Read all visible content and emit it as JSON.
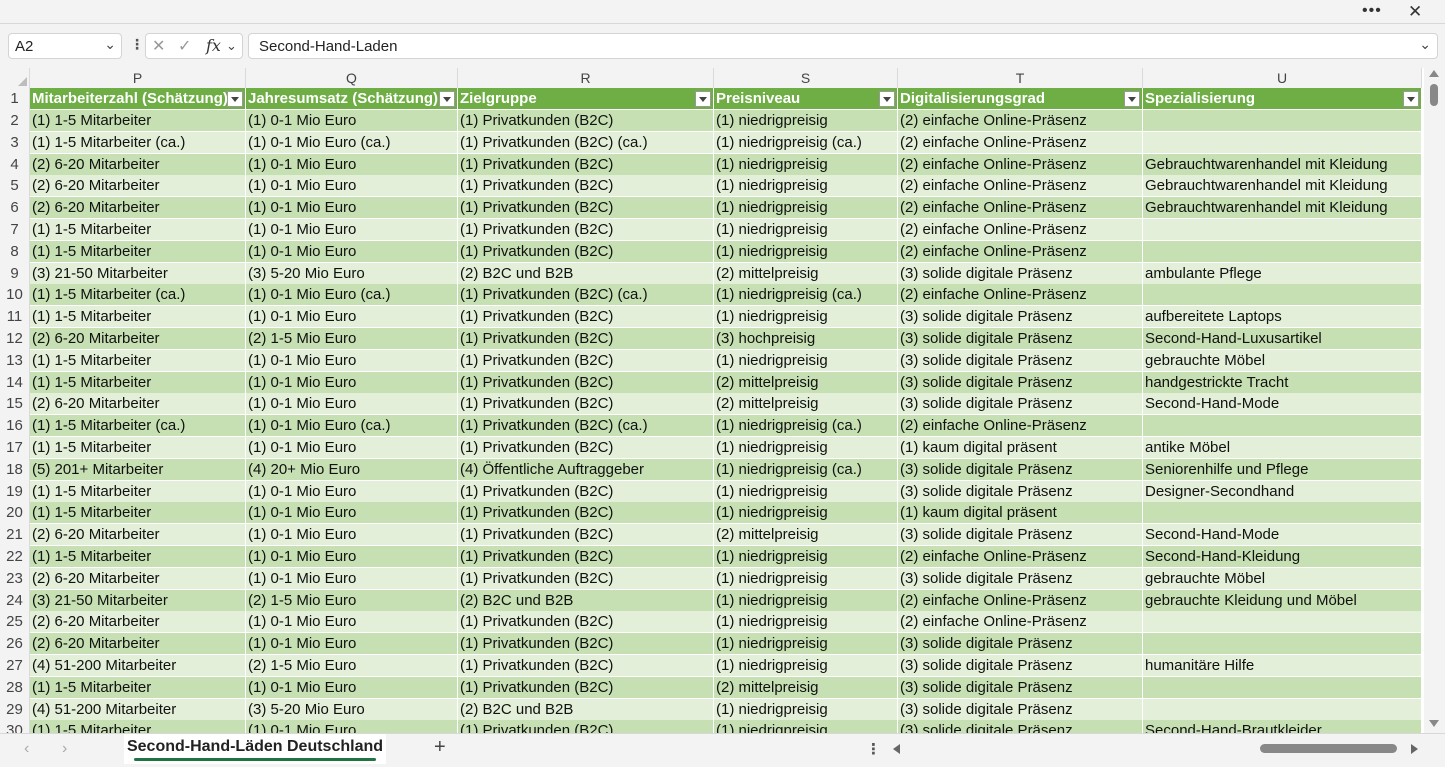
{
  "window": {
    "more_label": "•••",
    "close_label": "✕"
  },
  "formula_bar": {
    "name_box": "A2",
    "value": "Second-Hand-Laden",
    "cancel_icon": "✕",
    "enter_icon": "✓",
    "fx_label": "fx"
  },
  "columns": [
    "P",
    "Q",
    "R",
    "S",
    "T",
    "U"
  ],
  "header_row": {
    "number": "1",
    "cells": [
      "Mitarbeiterzahl (Schätzung)",
      "Jahresumsatz (Schätzung)",
      "Zielgruppe",
      "Preisniveau",
      "Digitalisierungsgrad",
      "Spezialisierung"
    ]
  },
  "rows": [
    {
      "number": "2",
      "cells": [
        "(1) 1-5 Mitarbeiter",
        "(1) 0-1 Mio Euro",
        "(1) Privatkunden (B2C)",
        "(1) niedrigpreisig",
        "(2) einfache Online-Präsenz",
        ""
      ]
    },
    {
      "number": "3",
      "cells": [
        "(1) 1-5 Mitarbeiter (ca.)",
        "(1) 0-1 Mio Euro (ca.)",
        "(1) Privatkunden (B2C) (ca.)",
        "(1) niedrigpreisig (ca.)",
        "(2) einfache Online-Präsenz",
        ""
      ]
    },
    {
      "number": "4",
      "cells": [
        "(2) 6-20 Mitarbeiter",
        "(1) 0-1 Mio Euro",
        "(1) Privatkunden (B2C)",
        "(1) niedrigpreisig",
        "(2) einfache Online-Präsenz",
        "Gebrauchtwarenhandel mit Kleidung"
      ]
    },
    {
      "number": "5",
      "cells": [
        "(2) 6-20 Mitarbeiter",
        "(1) 0-1 Mio Euro",
        "(1) Privatkunden (B2C)",
        "(1) niedrigpreisig",
        "(2) einfache Online-Präsenz",
        "Gebrauchtwarenhandel mit Kleidung"
      ]
    },
    {
      "number": "6",
      "cells": [
        "(2) 6-20 Mitarbeiter",
        "(1) 0-1 Mio Euro",
        "(1) Privatkunden (B2C)",
        "(1) niedrigpreisig",
        "(2) einfache Online-Präsenz",
        "Gebrauchtwarenhandel mit Kleidung"
      ]
    },
    {
      "number": "7",
      "cells": [
        "(1) 1-5 Mitarbeiter",
        "(1) 0-1 Mio Euro",
        "(1) Privatkunden (B2C)",
        "(1) niedrigpreisig",
        "(2) einfache Online-Präsenz",
        ""
      ]
    },
    {
      "number": "8",
      "cells": [
        "(1) 1-5 Mitarbeiter",
        "(1) 0-1 Mio Euro",
        "(1) Privatkunden (B2C)",
        "(1) niedrigpreisig",
        "(2) einfache Online-Präsenz",
        ""
      ]
    },
    {
      "number": "9",
      "cells": [
        "(3) 21-50 Mitarbeiter",
        "(3) 5-20 Mio Euro",
        "(2) B2C und B2B",
        "(2) mittelpreisig",
        "(3) solide digitale Präsenz",
        "ambulante Pflege"
      ]
    },
    {
      "number": "10",
      "cells": [
        "(1) 1-5 Mitarbeiter (ca.)",
        "(1) 0-1 Mio Euro (ca.)",
        "(1) Privatkunden (B2C) (ca.)",
        "(1) niedrigpreisig (ca.)",
        "(2) einfache Online-Präsenz",
        ""
      ]
    },
    {
      "number": "11",
      "cells": [
        "(1) 1-5 Mitarbeiter",
        "(1) 0-1 Mio Euro",
        "(1) Privatkunden (B2C)",
        "(1) niedrigpreisig",
        "(3) solide digitale Präsenz",
        "aufbereitete Laptops"
      ]
    },
    {
      "number": "12",
      "cells": [
        "(2) 6-20 Mitarbeiter",
        "(2) 1-5 Mio Euro",
        "(1) Privatkunden (B2C)",
        "(3) hochpreisig",
        "(3) solide digitale Präsenz",
        "Second-Hand-Luxusartikel"
      ]
    },
    {
      "number": "13",
      "cells": [
        "(1) 1-5 Mitarbeiter",
        "(1) 0-1 Mio Euro",
        "(1) Privatkunden (B2C)",
        "(1) niedrigpreisig",
        "(3) solide digitale Präsenz",
        "gebrauchte Möbel"
      ]
    },
    {
      "number": "14",
      "cells": [
        "(1) 1-5 Mitarbeiter",
        "(1) 0-1 Mio Euro",
        "(1) Privatkunden (B2C)",
        "(2) mittelpreisig",
        "(3) solide digitale Präsenz",
        "handgestrickte Tracht"
      ]
    },
    {
      "number": "15",
      "cells": [
        "(2) 6-20 Mitarbeiter",
        "(1) 0-1 Mio Euro",
        "(1) Privatkunden (B2C)",
        "(2) mittelpreisig",
        "(3) solide digitale Präsenz",
        "Second-Hand-Mode"
      ]
    },
    {
      "number": "16",
      "cells": [
        "(1) 1-5 Mitarbeiter (ca.)",
        "(1) 0-1 Mio Euro (ca.)",
        "(1) Privatkunden (B2C) (ca.)",
        "(1) niedrigpreisig (ca.)",
        "(2) einfache Online-Präsenz",
        ""
      ]
    },
    {
      "number": "17",
      "cells": [
        "(1) 1-5 Mitarbeiter",
        "(1) 0-1 Mio Euro",
        "(1) Privatkunden (B2C)",
        "(1) niedrigpreisig",
        "(1) kaum digital präsent",
        "antike Möbel"
      ]
    },
    {
      "number": "18",
      "cells": [
        "(5) 201+ Mitarbeiter",
        "(4) 20+ Mio Euro",
        "(4) Öffentliche Auftraggeber",
        "(1) niedrigpreisig (ca.)",
        "(3) solide digitale Präsenz",
        "Seniorenhilfe und Pflege"
      ]
    },
    {
      "number": "19",
      "cells": [
        "(1) 1-5 Mitarbeiter",
        "(1) 0-1 Mio Euro",
        "(1) Privatkunden (B2C)",
        "(1) niedrigpreisig",
        "(3) solide digitale Präsenz",
        "Designer-Secondhand"
      ]
    },
    {
      "number": "20",
      "cells": [
        "(1) 1-5 Mitarbeiter",
        "(1) 0-1 Mio Euro",
        "(1) Privatkunden (B2C)",
        "(1) niedrigpreisig",
        "(1) kaum digital präsent",
        ""
      ]
    },
    {
      "number": "21",
      "cells": [
        "(2) 6-20 Mitarbeiter",
        "(1) 0-1 Mio Euro",
        "(1) Privatkunden (B2C)",
        "(2) mittelpreisig",
        "(3) solide digitale Präsenz",
        "Second-Hand-Mode"
      ]
    },
    {
      "number": "22",
      "cells": [
        "(1) 1-5 Mitarbeiter",
        "(1) 0-1 Mio Euro",
        "(1) Privatkunden (B2C)",
        "(1) niedrigpreisig",
        "(2) einfache Online-Präsenz",
        "Second-Hand-Kleidung"
      ]
    },
    {
      "number": "23",
      "cells": [
        "(2) 6-20 Mitarbeiter",
        "(1) 0-1 Mio Euro",
        "(1) Privatkunden (B2C)",
        "(1) niedrigpreisig",
        "(3) solide digitale Präsenz",
        "gebrauchte Möbel"
      ]
    },
    {
      "number": "24",
      "cells": [
        "(3) 21-50 Mitarbeiter",
        "(2) 1-5 Mio Euro",
        "(2) B2C und B2B",
        "(1) niedrigpreisig",
        "(2) einfache Online-Präsenz",
        "gebrauchte Kleidung und Möbel"
      ]
    },
    {
      "number": "25",
      "cells": [
        "(2) 6-20 Mitarbeiter",
        "(1) 0-1 Mio Euro",
        "(1) Privatkunden (B2C)",
        "(1) niedrigpreisig",
        "(2) einfache Online-Präsenz",
        ""
      ]
    },
    {
      "number": "26",
      "cells": [
        "(2) 6-20 Mitarbeiter",
        "(1) 0-1 Mio Euro",
        "(1) Privatkunden (B2C)",
        "(1) niedrigpreisig",
        "(3) solide digitale Präsenz",
        ""
      ]
    },
    {
      "number": "27",
      "cells": [
        "(4) 51-200 Mitarbeiter",
        "(2) 1-5 Mio Euro",
        "(1) Privatkunden (B2C)",
        "(1) niedrigpreisig",
        "(3) solide digitale Präsenz",
        "humanitäre Hilfe"
      ]
    },
    {
      "number": "28",
      "cells": [
        "(1) 1-5 Mitarbeiter",
        "(1) 0-1 Mio Euro",
        "(1) Privatkunden (B2C)",
        "(2) mittelpreisig",
        "(3) solide digitale Präsenz",
        ""
      ]
    },
    {
      "number": "29",
      "cells": [
        "(4) 51-200 Mitarbeiter",
        "(3) 5-20 Mio Euro",
        "(2) B2C und B2B",
        "(1) niedrigpreisig",
        "(3) solide digitale Präsenz",
        ""
      ]
    },
    {
      "number": "30",
      "cells": [
        "(1) 1-5 Mitarbeiter",
        "(1) 0-1 Mio Euro",
        "(1) Privatkunden (B2C)",
        "(1) niedrigpreisig",
        "(3) solide digitale Präsenz",
        "Second-Hand-Brautkleider"
      ]
    }
  ],
  "sheet_tabs": {
    "active": "Second-Hand-Läden Deutschland",
    "add_label": "+"
  },
  "colors": {
    "header_green": "#6fae45",
    "band_dark": "#c6e0b3",
    "band_light": "#e3efd9",
    "tab_underline": "#217346"
  }
}
